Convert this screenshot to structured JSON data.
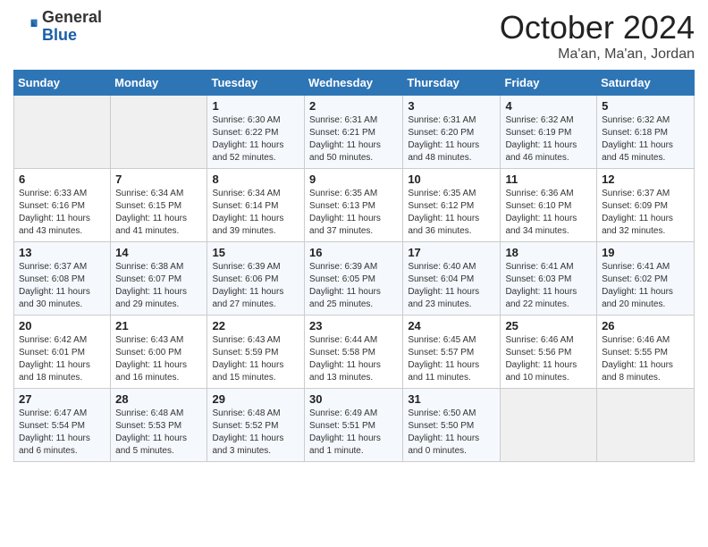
{
  "header": {
    "logo_general": "General",
    "logo_blue": "Blue",
    "month": "October 2024",
    "location": "Ma'an, Ma'an, Jordan"
  },
  "weekdays": [
    "Sunday",
    "Monday",
    "Tuesday",
    "Wednesday",
    "Thursday",
    "Friday",
    "Saturday"
  ],
  "weeks": [
    [
      {
        "day": "",
        "info": ""
      },
      {
        "day": "",
        "info": ""
      },
      {
        "day": "1",
        "info": "Sunrise: 6:30 AM\nSunset: 6:22 PM\nDaylight: 11 hours and 52 minutes."
      },
      {
        "day": "2",
        "info": "Sunrise: 6:31 AM\nSunset: 6:21 PM\nDaylight: 11 hours and 50 minutes."
      },
      {
        "day": "3",
        "info": "Sunrise: 6:31 AM\nSunset: 6:20 PM\nDaylight: 11 hours and 48 minutes."
      },
      {
        "day": "4",
        "info": "Sunrise: 6:32 AM\nSunset: 6:19 PM\nDaylight: 11 hours and 46 minutes."
      },
      {
        "day": "5",
        "info": "Sunrise: 6:32 AM\nSunset: 6:18 PM\nDaylight: 11 hours and 45 minutes."
      }
    ],
    [
      {
        "day": "6",
        "info": "Sunrise: 6:33 AM\nSunset: 6:16 PM\nDaylight: 11 hours and 43 minutes."
      },
      {
        "day": "7",
        "info": "Sunrise: 6:34 AM\nSunset: 6:15 PM\nDaylight: 11 hours and 41 minutes."
      },
      {
        "day": "8",
        "info": "Sunrise: 6:34 AM\nSunset: 6:14 PM\nDaylight: 11 hours and 39 minutes."
      },
      {
        "day": "9",
        "info": "Sunrise: 6:35 AM\nSunset: 6:13 PM\nDaylight: 11 hours and 37 minutes."
      },
      {
        "day": "10",
        "info": "Sunrise: 6:35 AM\nSunset: 6:12 PM\nDaylight: 11 hours and 36 minutes."
      },
      {
        "day": "11",
        "info": "Sunrise: 6:36 AM\nSunset: 6:10 PM\nDaylight: 11 hours and 34 minutes."
      },
      {
        "day": "12",
        "info": "Sunrise: 6:37 AM\nSunset: 6:09 PM\nDaylight: 11 hours and 32 minutes."
      }
    ],
    [
      {
        "day": "13",
        "info": "Sunrise: 6:37 AM\nSunset: 6:08 PM\nDaylight: 11 hours and 30 minutes."
      },
      {
        "day": "14",
        "info": "Sunrise: 6:38 AM\nSunset: 6:07 PM\nDaylight: 11 hours and 29 minutes."
      },
      {
        "day": "15",
        "info": "Sunrise: 6:39 AM\nSunset: 6:06 PM\nDaylight: 11 hours and 27 minutes."
      },
      {
        "day": "16",
        "info": "Sunrise: 6:39 AM\nSunset: 6:05 PM\nDaylight: 11 hours and 25 minutes."
      },
      {
        "day": "17",
        "info": "Sunrise: 6:40 AM\nSunset: 6:04 PM\nDaylight: 11 hours and 23 minutes."
      },
      {
        "day": "18",
        "info": "Sunrise: 6:41 AM\nSunset: 6:03 PM\nDaylight: 11 hours and 22 minutes."
      },
      {
        "day": "19",
        "info": "Sunrise: 6:41 AM\nSunset: 6:02 PM\nDaylight: 11 hours and 20 minutes."
      }
    ],
    [
      {
        "day": "20",
        "info": "Sunrise: 6:42 AM\nSunset: 6:01 PM\nDaylight: 11 hours and 18 minutes."
      },
      {
        "day": "21",
        "info": "Sunrise: 6:43 AM\nSunset: 6:00 PM\nDaylight: 11 hours and 16 minutes."
      },
      {
        "day": "22",
        "info": "Sunrise: 6:43 AM\nSunset: 5:59 PM\nDaylight: 11 hours and 15 minutes."
      },
      {
        "day": "23",
        "info": "Sunrise: 6:44 AM\nSunset: 5:58 PM\nDaylight: 11 hours and 13 minutes."
      },
      {
        "day": "24",
        "info": "Sunrise: 6:45 AM\nSunset: 5:57 PM\nDaylight: 11 hours and 11 minutes."
      },
      {
        "day": "25",
        "info": "Sunrise: 6:46 AM\nSunset: 5:56 PM\nDaylight: 11 hours and 10 minutes."
      },
      {
        "day": "26",
        "info": "Sunrise: 6:46 AM\nSunset: 5:55 PM\nDaylight: 11 hours and 8 minutes."
      }
    ],
    [
      {
        "day": "27",
        "info": "Sunrise: 6:47 AM\nSunset: 5:54 PM\nDaylight: 11 hours and 6 minutes."
      },
      {
        "day": "28",
        "info": "Sunrise: 6:48 AM\nSunset: 5:53 PM\nDaylight: 11 hours and 5 minutes."
      },
      {
        "day": "29",
        "info": "Sunrise: 6:48 AM\nSunset: 5:52 PM\nDaylight: 11 hours and 3 minutes."
      },
      {
        "day": "30",
        "info": "Sunrise: 6:49 AM\nSunset: 5:51 PM\nDaylight: 11 hours and 1 minute."
      },
      {
        "day": "31",
        "info": "Sunrise: 6:50 AM\nSunset: 5:50 PM\nDaylight: 11 hours and 0 minutes."
      },
      {
        "day": "",
        "info": ""
      },
      {
        "day": "",
        "info": ""
      }
    ]
  ]
}
